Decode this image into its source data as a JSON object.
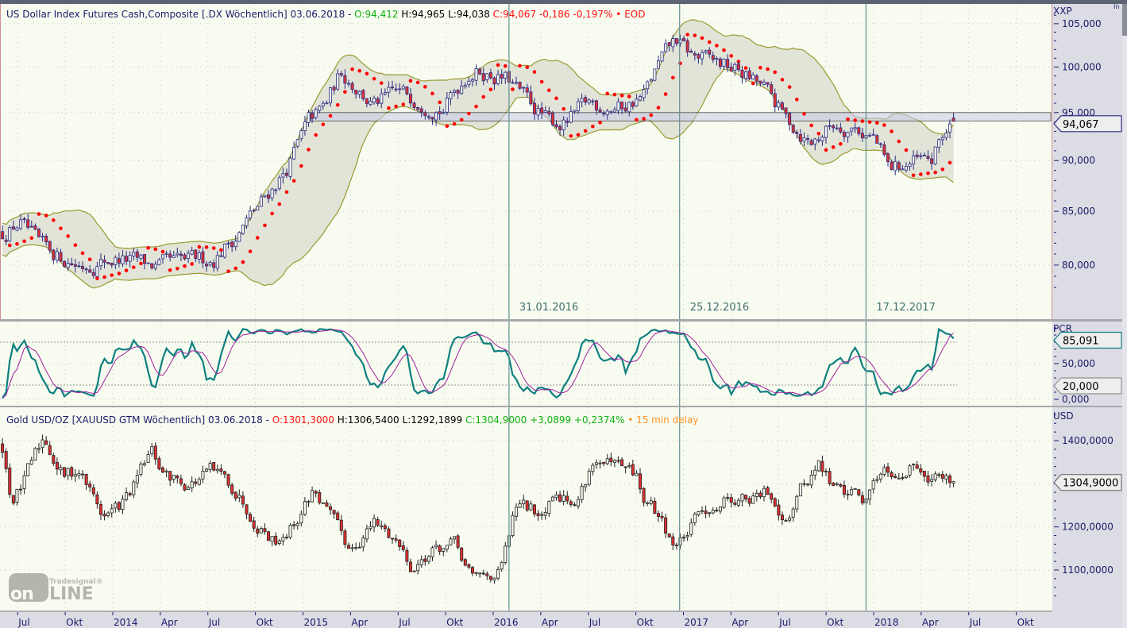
{
  "colors": {
    "plot_bg": "#f8fbf0",
    "axis_bg": "#dcdce4",
    "dx_candle": "#2a2a80",
    "down_fill": "#e23030",
    "band_fill": "#dcdfd2",
    "band_line": "#9a9a30",
    "sar": "#ff0000",
    "pcr_main": "#0f8080",
    "pcr_signal": "#a020a0",
    "event_line": "#5f9090"
  },
  "corner_label": "In",
  "logo": {
    "small": "Tradesignal®",
    "big": "onLine"
  },
  "chart_data": {
    "type": "candlestick",
    "x_axis": {
      "ticks": [
        {
          "t": 2013.5,
          "label": "Jul"
        },
        {
          "t": 2013.75,
          "label": "Okt"
        },
        {
          "t": 2014.0,
          "label": "2014"
        },
        {
          "t": 2014.25,
          "label": "Apr"
        },
        {
          "t": 2014.5,
          "label": "Jul"
        },
        {
          "t": 2014.75,
          "label": "Okt"
        },
        {
          "t": 2015.0,
          "label": "2015"
        },
        {
          "t": 2015.25,
          "label": "Apr"
        },
        {
          "t": 2015.5,
          "label": "Jul"
        },
        {
          "t": 2015.75,
          "label": "Okt"
        },
        {
          "t": 2016.0,
          "label": "2016"
        },
        {
          "t": 2016.25,
          "label": "Apr"
        },
        {
          "t": 2016.5,
          "label": "Jul"
        },
        {
          "t": 2016.75,
          "label": "Okt"
        },
        {
          "t": 2017.0,
          "label": "2017"
        },
        {
          "t": 2017.25,
          "label": "Apr"
        },
        {
          "t": 2017.5,
          "label": "Jul"
        },
        {
          "t": 2017.75,
          "label": "Okt"
        },
        {
          "t": 2018.0,
          "label": "2018"
        },
        {
          "t": 2018.25,
          "label": "Apr"
        },
        {
          "t": 2018.5,
          "label": "Jul"
        },
        {
          "t": 2018.75,
          "label": "Okt"
        }
      ],
      "first_bar": 2013.42,
      "last_bar": 2018.42
    },
    "events": [
      {
        "t": 2016.083,
        "label": "31.01.2016"
      },
      {
        "t": 2016.98,
        "label": "25.12.2016"
      },
      {
        "t": 2017.96,
        "label": "17.12.2017"
      }
    ],
    "dx": {
      "header": {
        "name": "US Dollar Index Futures Cash,Composite [.DX Wöchentlich] 03.06.2018 - ",
        "open": "O:94,412",
        "high": " H:94,965",
        "low": " L:94,038",
        "close": " C:94,067 -0,186 -0,197%",
        "dot": " • ",
        "src": "EOD"
      },
      "unit": "XXP",
      "scale": "log",
      "ylim": [
        76.5,
        107
      ],
      "yticks": [
        {
          "v": 105,
          "label": "105,000"
        },
        {
          "v": 100,
          "label": "100,000"
        },
        {
          "v": 95,
          "label": "95,000"
        },
        {
          "v": 90,
          "label": "90,000"
        },
        {
          "v": 85,
          "label": "85,000"
        },
        {
          "v": 80,
          "label": "80,000"
        }
      ],
      "last": {
        "open": 94.412,
        "high": 94.965,
        "low": 94.038,
        "close": 94.067,
        "label": "94,067"
      },
      "zone": {
        "from": 2015.04,
        "low": 94.1,
        "high": 95.0
      },
      "indicators": [
        "Bollinger Bands (20,2)",
        "Parabolic SAR"
      ],
      "anchors": [
        [
          2013.42,
          83.0
        ],
        [
          2013.51,
          84.0
        ],
        [
          2013.62,
          81.5
        ],
        [
          2013.83,
          80.0
        ],
        [
          2014.03,
          80.6
        ],
        [
          2014.24,
          79.8
        ],
        [
          2014.41,
          80.3
        ],
        [
          2014.53,
          80.6
        ],
        [
          2014.66,
          83.0
        ],
        [
          2014.79,
          86.0
        ],
        [
          2014.91,
          89.1
        ],
        [
          2015.03,
          93.9
        ],
        [
          2015.12,
          95.7
        ],
        [
          2015.2,
          99.5
        ],
        [
          2015.28,
          97.9
        ],
        [
          2015.37,
          95.7
        ],
        [
          2015.49,
          97.0
        ],
        [
          2015.62,
          96.5
        ],
        [
          2015.74,
          95.5
        ],
        [
          2015.87,
          99.5
        ],
        [
          2015.95,
          99.5
        ],
        [
          2016.08,
          98.5
        ],
        [
          2016.16,
          96.6
        ],
        [
          2016.29,
          94.0
        ],
        [
          2016.38,
          93.8
        ],
        [
          2016.5,
          96.0
        ],
        [
          2016.67,
          95.5
        ],
        [
          2016.79,
          96.8
        ],
        [
          2016.88,
          100.6
        ],
        [
          2016.96,
          103.0
        ],
        [
          2017.04,
          101.3
        ],
        [
          2017.17,
          100.5
        ],
        [
          2017.29,
          99.6
        ],
        [
          2017.42,
          97.6
        ],
        [
          2017.54,
          94.3
        ],
        [
          2017.67,
          91.8
        ],
        [
          2017.79,
          93.8
        ],
        [
          2017.9,
          93.5
        ],
        [
          2018.0,
          92.4
        ],
        [
          2018.08,
          89.0
        ],
        [
          2018.21,
          89.8
        ],
        [
          2018.31,
          89.8
        ],
        [
          2018.35,
          92.2
        ],
        [
          2018.42,
          94.067
        ]
      ]
    },
    "pcr": {
      "unit": "PCR",
      "ylim": [
        -5,
        106
      ],
      "yticks": [
        {
          "v": 50,
          "label": "50,000"
        },
        {
          "v": 0,
          "label": "0,000"
        }
      ],
      "levels": [
        80,
        20
      ],
      "last": {
        "value": 85.091,
        "label": "85,091"
      },
      "level_label": "20,000"
    },
    "gold": {
      "header": {
        "name": "Gold USD/OZ [XAUUSD GTM Wöchentlich] 03.06.2018 - ",
        "open": "O:1301,3000",
        "high": " H:1306,5400",
        "low": " L:1292,1899",
        "close": " C:1304,9000 +3,0899 +0,2374%",
        "dot": " • ",
        "src": "15 min delay"
      },
      "unit": "USD",
      "ylim": [
        1020,
        1465
      ],
      "yticks": [
        {
          "v": 1400,
          "label": "1400,0000"
        },
        {
          "v": 1300,
          "label": "1300,0000"
        },
        {
          "v": 1200,
          "label": "1200,0000"
        },
        {
          "v": 1100,
          "label": "1100,0000"
        }
      ],
      "last": {
        "open": 1301.3,
        "high": 1306.54,
        "low": 1292.1899,
        "close": 1304.9,
        "label": "1304,9000"
      },
      "anchors": [
        [
          2013.42,
          1390
        ],
        [
          2013.47,
          1262
        ],
        [
          2013.53,
          1300
        ],
        [
          2013.64,
          1409
        ],
        [
          2013.68,
          1372
        ],
        [
          2013.74,
          1317
        ],
        [
          2013.82,
          1335
        ],
        [
          2013.95,
          1225
        ],
        [
          2014.03,
          1245
        ],
        [
          2014.1,
          1280
        ],
        [
          2014.2,
          1372
        ],
        [
          2014.28,
          1317
        ],
        [
          2014.41,
          1300
        ],
        [
          2014.51,
          1326
        ],
        [
          2014.62,
          1300
        ],
        [
          2014.74,
          1225
        ],
        [
          2014.85,
          1170
        ],
        [
          2014.95,
          1207
        ],
        [
          2015.06,
          1290
        ],
        [
          2015.16,
          1207
        ],
        [
          2015.24,
          1150
        ],
        [
          2015.37,
          1207
        ],
        [
          2015.49,
          1170
        ],
        [
          2015.58,
          1105
        ],
        [
          2015.66,
          1142
        ],
        [
          2015.79,
          1160
        ],
        [
          2015.89,
          1078
        ],
        [
          2016.04,
          1096
        ],
        [
          2016.12,
          1244
        ],
        [
          2016.25,
          1235
        ],
        [
          2016.33,
          1299
        ],
        [
          2016.43,
          1244
        ],
        [
          2016.52,
          1354
        ],
        [
          2016.62,
          1335
        ],
        [
          2016.75,
          1317
        ],
        [
          2016.79,
          1262
        ],
        [
          2016.87,
          1225
        ],
        [
          2016.96,
          1152
        ],
        [
          2017.04,
          1198
        ],
        [
          2017.12,
          1243
        ],
        [
          2017.25,
          1271
        ],
        [
          2017.37,
          1262
        ],
        [
          2017.45,
          1280
        ],
        [
          2017.54,
          1225
        ],
        [
          2017.62,
          1290
        ],
        [
          2017.71,
          1345
        ],
        [
          2017.79,
          1290
        ],
        [
          2017.91,
          1280
        ],
        [
          2017.96,
          1262
        ],
        [
          2018.04,
          1345
        ],
        [
          2018.12,
          1335
        ],
        [
          2018.25,
          1345
        ],
        [
          2018.33,
          1317
        ],
        [
          2018.42,
          1304.9
        ]
      ]
    }
  }
}
